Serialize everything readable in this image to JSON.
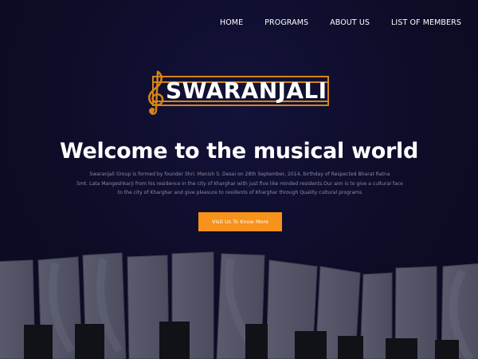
{
  "nav": {
    "items": [
      {
        "label": "HOME"
      },
      {
        "label": "PROGRAMS"
      },
      {
        "label": "ABOUT US"
      },
      {
        "label": "LIST OF MEMBERS"
      }
    ]
  },
  "logo": {
    "text": "SWARANJALI",
    "icon": "treble-clef-icon"
  },
  "hero": {
    "title": "Welcome to the musical world",
    "desc_line1": "Swaranjali Group is formed by founder Shri. Manish S. Desai on 28th September, 2014, birthday of Respected Bharat Ratna",
    "desc_line2": "Smt. Lata Mangeshkarji from his residence in the city of kharghar with just five like minded residents.Our aim is to give a cultural face",
    "desc_line3": "to the city of Kharghar and give pleasure to residents of Kharghar through Quality cultural programs",
    "cta_label": "Visit Us To Know More"
  },
  "colors": {
    "background": "#0d0c26",
    "accent": "#f7921a",
    "logo_gold": "#d68416"
  }
}
